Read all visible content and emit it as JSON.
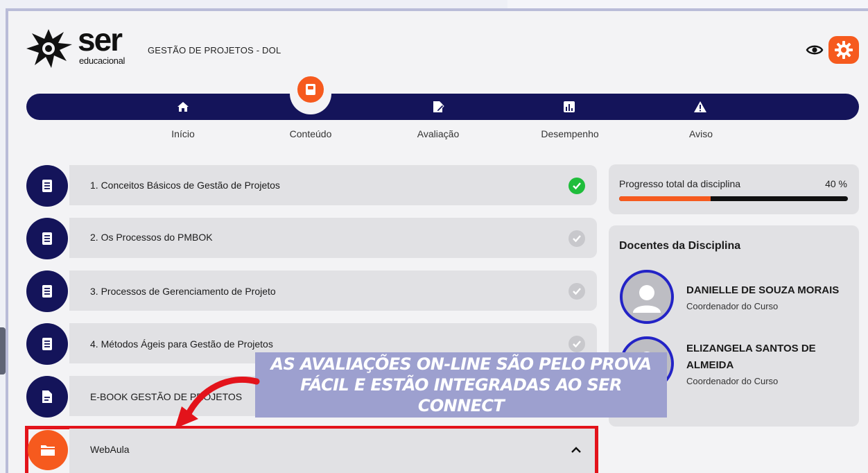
{
  "header": {
    "logo_text": "ser",
    "logo_subtext": "educacional",
    "course_title": "GESTÃO DE PROJETOS - DOL"
  },
  "nav": {
    "items": [
      {
        "label": "Início",
        "icon": "home-icon"
      },
      {
        "label": "Conteúdo",
        "icon": "book-icon",
        "active": true
      },
      {
        "label": "Avaliação",
        "icon": "edit-icon"
      },
      {
        "label": "Desempenho",
        "icon": "bar-chart-icon"
      },
      {
        "label": "Aviso",
        "icon": "warning-icon"
      }
    ]
  },
  "modules": [
    {
      "label": "1. Conceitos Básicos de Gestão de Projetos",
      "status": "done"
    },
    {
      "label": "2. Os Processos do PMBOK",
      "status": "todo"
    },
    {
      "label": "3. Processos de Gerenciamento de Projeto",
      "status": "todo"
    },
    {
      "label": "4. Métodos Ágeis para Gestão de Projetos",
      "status": "todo"
    },
    {
      "label": "E-BOOK GESTÃO DE PROJETOS",
      "status": "none"
    }
  ],
  "webaula": {
    "label": "WebAula"
  },
  "progress": {
    "label": "Progresso total da disciplina",
    "percent_text": "40 %",
    "value": 0.4
  },
  "teachers": {
    "title": "Docentes da Disciplina",
    "list": [
      {
        "name": "DANIELLE DE SOUZA MORAIS",
        "role": "Coordenador do Curso"
      },
      {
        "name": "ELIZANGELA SANTOS DE ALMEIDA",
        "role": "Coordenador do Curso"
      }
    ]
  },
  "callout": {
    "line1": "AS AVALIAÇÕES ON-LINE SÃO PELO PROVA",
    "line2": "FÁCIL E ESTÃO INTEGRADAS AO SER CONNECT"
  },
  "colors": {
    "navy": "#14145a",
    "accent": "#f65a1e",
    "success": "#1fbd3b",
    "highlight_border": "#e3131b",
    "callout_bg": "#9da0cf"
  }
}
